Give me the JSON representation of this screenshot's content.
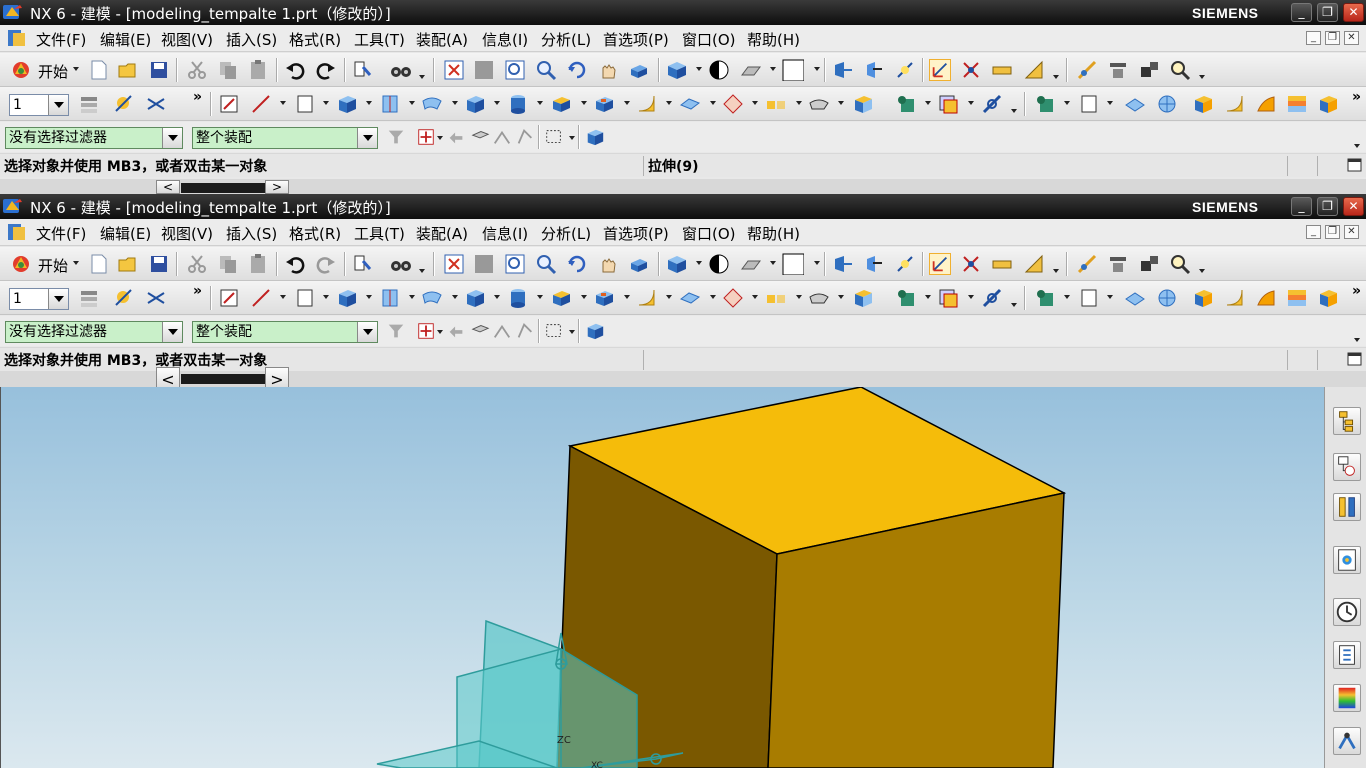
{
  "app": {
    "title": "NX 6 - 建模 - [modeling_tempalte 1.prt（修改的）]",
    "brand": "SIEMENS",
    "window_buttons": {
      "minimize": "_",
      "restore": "❐",
      "close": "✕"
    }
  },
  "menu": {
    "items": [
      "文件(F)",
      "编辑(E)",
      "视图(V)",
      "插入(S)",
      "格式(R)",
      "工具(T)",
      "装配(A)",
      "信息(I)",
      "分析(L)",
      "首选项(P)",
      "窗口(O)",
      "帮助(H)"
    ],
    "mdi_buttons": [
      "_",
      "❐",
      "✕"
    ]
  },
  "toolbar": {
    "start_label": "开始",
    "layer_value": "1"
  },
  "selection": {
    "filter_value": "没有选择过滤器",
    "scope_value": "整个装配"
  },
  "cue": {
    "prompt": "选择对象并使用 MB3，或者双击某一对象",
    "status": "拉伸(9)"
  },
  "scroll": {
    "left": "<",
    "right": ">"
  },
  "viewport": {
    "axis_labels": [
      "ZC",
      "XC"
    ]
  },
  "colors": {
    "titlebar": "#111111",
    "model_top": "#f5bc0a",
    "model_front": "#7a5800",
    "model_side": "#a87c00",
    "datum_plane": "#58c8c8",
    "filter_field": "#c9f0c9"
  },
  "resource_bar": {
    "icons": [
      "assembly-navigator-icon",
      "part-navigator-icon",
      "constraint-navigator-icon",
      "web-browser-icon",
      "history-icon",
      "system-materials-icon",
      "roles-icon",
      "process-studio-icon"
    ]
  }
}
